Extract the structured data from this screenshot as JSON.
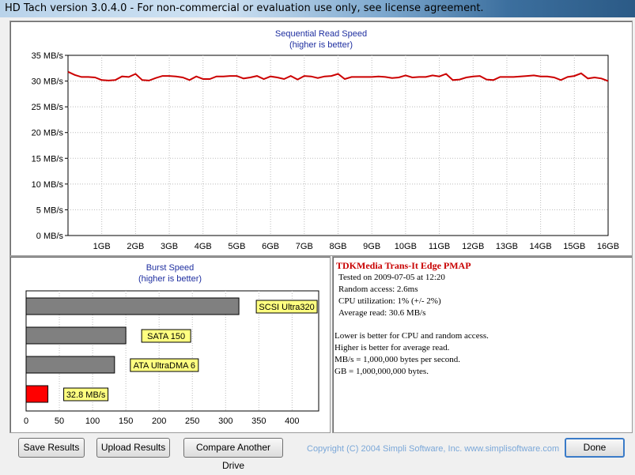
{
  "window": {
    "title": "HD Tach version 3.0.4.0  - For non-commercial or evaluation use only, see license agreement."
  },
  "sequential": {
    "title": "Sequential Read Speed",
    "subtitle": "(higher is better)"
  },
  "burst": {
    "title": "Burst Speed",
    "subtitle": "(higher is better)"
  },
  "info": {
    "drive": "TDKMedia  Trans-It Edge PMAP",
    "tested": "Tested on 2009-07-05 at 12:20",
    "random_access": "Random access: 2.6ms",
    "cpu": "CPU utilization: 1% (+/- 2%)",
    "average": "Average read: 30.6 MB/s",
    "note1": "Lower is better for CPU and random access.",
    "note2": "Higher is better for average read.",
    "note3": "MB/s = 1,000,000 bytes per second.",
    "note4": "GB = 1,000,000,000 bytes."
  },
  "buttons": {
    "save": "Save Results",
    "upload": "Upload Results",
    "compare": "Compare Another Drive",
    "done": "Done"
  },
  "footer": {
    "copyright": "Copyright (C) 2004 Simpli Software, Inc. www.simplisoftware.com"
  },
  "colors": {
    "line": "#cc0000",
    "bar": "#808080",
    "bar_current": "#ff0000",
    "label_bg": "#ffff80",
    "title": "#1f2fa0"
  },
  "chart_data": [
    {
      "type": "line",
      "title": "Sequential Read Speed",
      "subtitle": "(higher is better)",
      "xlabel": "",
      "ylabel": "",
      "y_ticks": [
        "0 MB/s",
        "5 MB/s",
        "10 MB/s",
        "15 MB/s",
        "20 MB/s",
        "25 MB/s",
        "30 MB/s",
        "35 MB/s"
      ],
      "x_ticks": [
        "1GB",
        "2GB",
        "3GB",
        "4GB",
        "5GB",
        "6GB",
        "7GB",
        "8GB",
        "9GB",
        "10GB",
        "11GB",
        "12GB",
        "13GB",
        "14GB",
        "15GB",
        "16GB"
      ],
      "ylim": [
        0,
        35
      ],
      "xlim": [
        0,
        16
      ],
      "grid": true,
      "series": [
        {
          "x": [
            0,
            0.2,
            0.4,
            0.6,
            0.8,
            1.0,
            1.2,
            1.4,
            1.6,
            1.8,
            2.0,
            2.2,
            2.4,
            2.6,
            2.8,
            3.0,
            3.2,
            3.4,
            3.6,
            3.8,
            4.0,
            4.2,
            4.4,
            4.6,
            4.8,
            5.0,
            5.2,
            5.4,
            5.6,
            5.8,
            6.0,
            6.2,
            6.4,
            6.6,
            6.8,
            7.0,
            7.2,
            7.4,
            7.6,
            7.8,
            8.0,
            8.2,
            8.4,
            8.6,
            8.8,
            9.0,
            9.2,
            9.4,
            9.6,
            9.8,
            10.0,
            10.2,
            10.4,
            10.6,
            10.8,
            11.0,
            11.2,
            11.4,
            11.6,
            11.8,
            12.0,
            12.2,
            12.4,
            12.6,
            12.8,
            13.0,
            13.2,
            13.4,
            13.6,
            13.8,
            14.0,
            14.2,
            14.4,
            14.6,
            14.8,
            15.0,
            15.2,
            15.4,
            15.6,
            15.8,
            16.0
          ],
          "y": [
            31.8,
            31.2,
            30.8,
            30.8,
            30.7,
            30.2,
            30.1,
            30.2,
            30.9,
            30.8,
            31.4,
            30.2,
            30.1,
            30.6,
            31.0,
            31.0,
            30.9,
            30.7,
            30.2,
            30.9,
            30.4,
            30.4,
            30.9,
            30.9,
            31.0,
            31.0,
            30.5,
            30.7,
            31.0,
            30.4,
            30.9,
            30.7,
            30.4,
            31.0,
            30.3,
            31.0,
            30.9,
            30.6,
            30.9,
            31.0,
            31.4,
            30.4,
            30.8,
            30.8,
            30.8,
            30.8,
            30.9,
            30.8,
            30.6,
            30.7,
            31.1,
            30.7,
            30.8,
            30.8,
            31.1,
            30.9,
            31.4,
            30.2,
            30.3,
            30.7,
            30.9,
            31.0,
            30.3,
            30.2,
            30.8,
            30.8,
            30.8,
            30.9,
            31.0,
            31.1,
            30.9,
            30.9,
            30.7,
            30.2,
            30.8,
            31.0,
            31.5,
            30.5,
            30.7,
            30.5,
            30.0
          ]
        }
      ]
    },
    {
      "type": "bar",
      "orientation": "horizontal",
      "title": "Burst Speed",
      "subtitle": "(higher is better)",
      "x_ticks": [
        "0",
        "50",
        "100",
        "150",
        "200",
        "250",
        "300",
        "350",
        "400"
      ],
      "xlim": [
        0,
        440
      ],
      "grid": true,
      "bars": [
        {
          "label": "SCSI Ultra320",
          "value": 320,
          "color": "#808080"
        },
        {
          "label": "SATA 150",
          "value": 150,
          "color": "#808080"
        },
        {
          "label": "ATA UltraDMA 6",
          "value": 133,
          "color": "#808080"
        },
        {
          "label": "32.8 MB/s",
          "value": 32.8,
          "color": "#ff0000"
        }
      ]
    }
  ]
}
